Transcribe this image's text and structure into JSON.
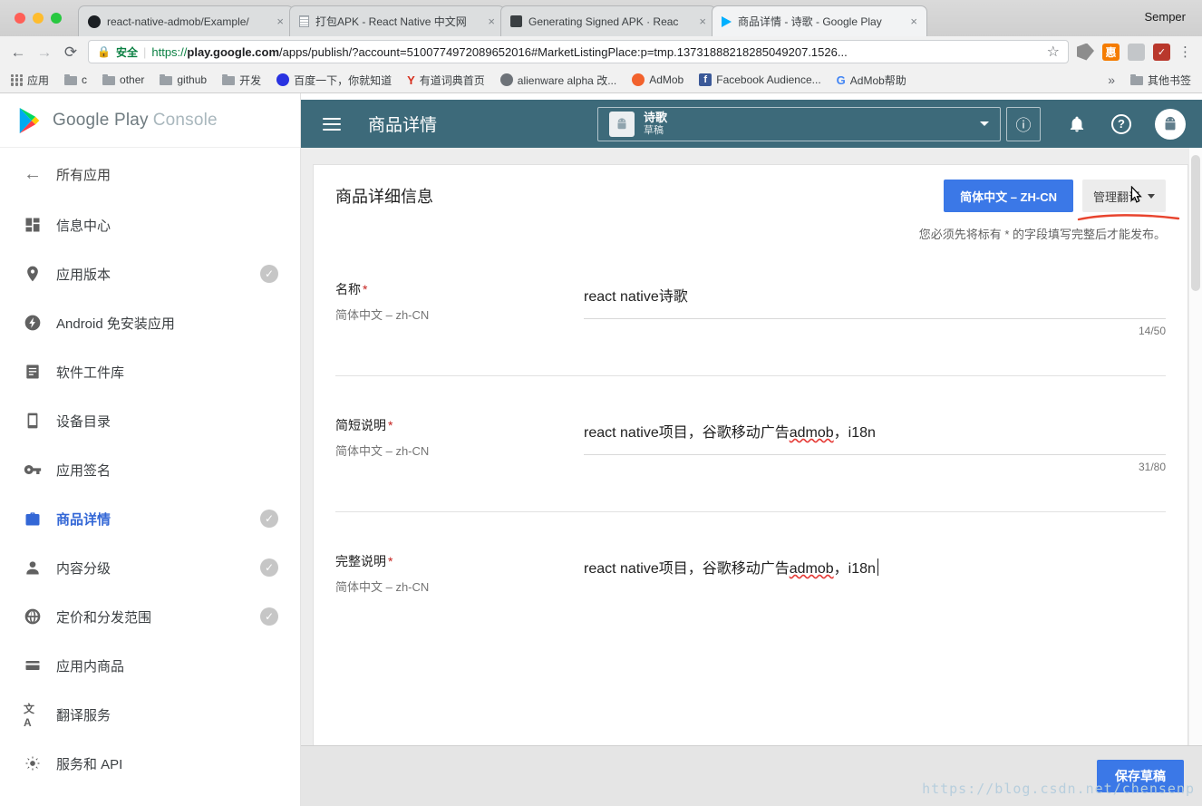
{
  "required_mark": "*",
  "misspelled_words": [
    "admob"
  ],
  "colors": {
    "accent_blue": "#3b78e7",
    "header_teal": "#3d6a7a",
    "annotation_red": "#e8442e",
    "active_item_blue": "#3367d6"
  },
  "browser": {
    "window_label": "Semper",
    "tabs": [
      {
        "title": "react-native-admob/Example/"
      },
      {
        "title": "打包APK - React Native 中文网"
      },
      {
        "title": "Generating Signed APK · Reac"
      },
      {
        "title": "商品详情 - 诗歌 - Google Play"
      }
    ],
    "toolbar": {
      "security_label": "安全",
      "url_scheme": "https://",
      "url_domain": "play.google.com",
      "url_path": "/apps/publish/?account=5100774972089652016#MarketListingPlace:p=tmp.13731888218285049207.1526..."
    },
    "icon_glyphs": {
      "huihui": "惠",
      "youdao": "Y",
      "facebook": "f",
      "google": "G"
    },
    "bookmarks": {
      "apps_label": "应用",
      "items": [
        {
          "label": "c"
        },
        {
          "label": "other"
        },
        {
          "label": "github"
        },
        {
          "label": "开发"
        },
        {
          "label": "百度一下，你就知道"
        },
        {
          "label": "有道词典首页"
        },
        {
          "label": "alienware alpha 改..."
        },
        {
          "label": "AdMob"
        },
        {
          "label": "Facebook Audience..."
        },
        {
          "label": "AdMob帮助"
        }
      ],
      "other_bookmarks": "其他书签"
    }
  },
  "console": {
    "logo_primary": "Google Play",
    "logo_secondary": "Console",
    "sidebar": {
      "back_label": "所有应用",
      "items": [
        {
          "label": "信息中心"
        },
        {
          "label": "应用版本",
          "checked": true
        },
        {
          "label": "Android 免安装应用"
        },
        {
          "label": "软件工件库"
        },
        {
          "label": "设备目录"
        },
        {
          "label": "应用签名"
        },
        {
          "label": "商品详情",
          "checked": true,
          "active": true
        },
        {
          "label": "内容分级",
          "checked": true
        },
        {
          "label": "定价和分发范围",
          "checked": true
        },
        {
          "label": "应用内商品"
        },
        {
          "label": "翻译服务"
        },
        {
          "label": "服务和 API"
        }
      ]
    },
    "topbar": {
      "title": "商品详情",
      "app_name": "诗歌",
      "app_status": "草稿"
    },
    "page": {
      "card_title": "商品详细信息",
      "language_button": "简体中文 – ZH-CN",
      "manage_translations_button": "管理翻译",
      "required_note": "您必须先将标有 * 的字段填写完整后才能发布。",
      "fields": [
        {
          "label": "名称",
          "locale": "简体中文 – zh-CN",
          "value": "react native诗歌",
          "counter": "14/50"
        },
        {
          "label": "简短说明",
          "locale": "简体中文 – zh-CN",
          "value": "react native项目，谷歌移动广告admob，i18n",
          "counter": "31/80"
        },
        {
          "label": "完整说明",
          "locale": "简体中文 – zh-CN",
          "value": "react native项目，谷歌移动广告admob，i18n"
        }
      ],
      "save_button": "保存草稿"
    },
    "watermark": "https://blog.csdn.net/chensenp"
  }
}
